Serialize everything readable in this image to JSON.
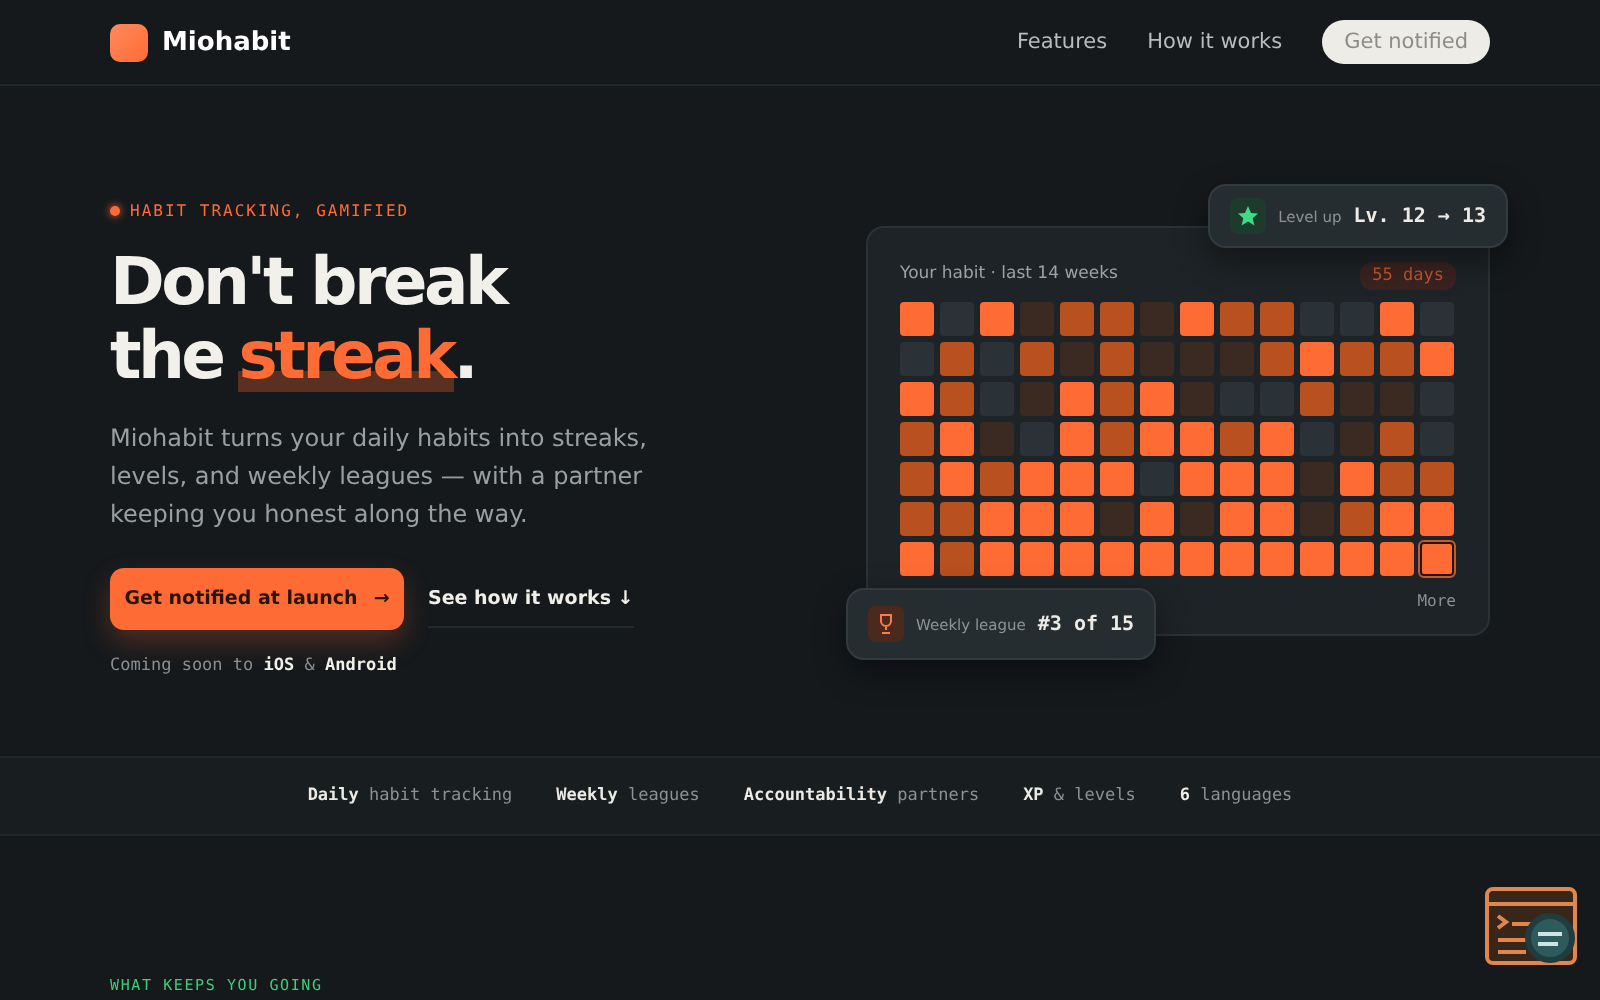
{
  "header": {
    "brand": "Miohabit",
    "nav": [
      "Features",
      "How it works"
    ],
    "cta": "Get notified"
  },
  "hero": {
    "eyebrow": "HABIT TRACKING, GAMIFIED",
    "heading_line1": "Don't break",
    "heading_line2_start": "the",
    "heading_highlight": "streak",
    "heading_line2_end": ".",
    "description": "Miohabit turns your daily habits into streaks, levels, and weekly leagues — with a partner keeping you honest along the way.",
    "primary_button": "Get notified at launch",
    "primary_arrow": "→",
    "secondary_link": "See how it works ↓",
    "availability": "Coming soon to **iOS** & **Android**"
  },
  "habit_card": {
    "title": "Your habit · last 14 weeks",
    "streak_badge": "55 days",
    "more": "More",
    "today_outlined": true,
    "rows": [
      [
        {
          "color": "#ff6b35"
        },
        {
          "color": "#2a3137"
        },
        {
          "color": "#ff6b35"
        },
        {
          "color": "#3b2a22"
        },
        {
          "color": "#b8501f"
        },
        {
          "color": "#b8501f"
        },
        {
          "color": "#3b2a22"
        },
        {
          "color": "#ff6b35"
        },
        {
          "color": "#b8501f"
        },
        {
          "color": "#b8501f"
        },
        {
          "color": "#2a3137"
        },
        {
          "color": "#2a3137"
        },
        {
          "color": "#ff6b35"
        },
        {
          "color": "#2a3137"
        }
      ],
      [
        {
          "color": "#2a3137"
        },
        {
          "color": "#b8501f"
        },
        {
          "color": "#2a3137"
        },
        {
          "color": "#b8501f"
        },
        {
          "color": "#3b2a22"
        },
        {
          "color": "#b8501f"
        },
        {
          "color": "#3b2a22"
        },
        {
          "color": "#3b2a22"
        },
        {
          "color": "#3b2a22"
        },
        {
          "color": "#b8501f"
        },
        {
          "color": "#ff6b35"
        },
        {
          "color": "#b8501f"
        },
        {
          "color": "#b8501f"
        },
        {
          "color": "#ff6b35"
        }
      ],
      [
        {
          "color": "#ff6b35"
        },
        {
          "color": "#b8501f"
        },
        {
          "color": "#2a3137"
        },
        {
          "color": "#3b2a22"
        },
        {
          "color": "#ff6b35"
        },
        {
          "color": "#b8501f"
        },
        {
          "color": "#ff6b35"
        },
        {
          "color": "#3b2a22"
        },
        {
          "color": "#2a3137"
        },
        {
          "color": "#2a3137"
        },
        {
          "color": "#b8501f"
        },
        {
          "color": "#3b2a22"
        },
        {
          "color": "#3b2a22"
        },
        {
          "color": "#2a3137"
        }
      ],
      [
        {
          "color": "#b8501f"
        },
        {
          "color": "#ff6b35"
        },
        {
          "color": "#3b2a22"
        },
        {
          "color": "#2a3137"
        },
        {
          "color": "#ff6b35"
        },
        {
          "color": "#b8501f"
        },
        {
          "color": "#ff6b35"
        },
        {
          "color": "#ff6b35"
        },
        {
          "color": "#b8501f"
        },
        {
          "color": "#ff6b35"
        },
        {
          "color": "#2a3137"
        },
        {
          "color": "#3b2a22"
        },
        {
          "color": "#b8501f"
        },
        {
          "color": "#2a3137"
        }
      ],
      [
        {
          "color": "#b8501f"
        },
        {
          "color": "#ff6b35"
        },
        {
          "color": "#b8501f"
        },
        {
          "color": "#ff6b35"
        },
        {
          "color": "#ff6b35"
        },
        {
          "color": "#ff6b35"
        },
        {
          "color": "#2a3137"
        },
        {
          "color": "#ff6b35"
        },
        {
          "color": "#ff6b35"
        },
        {
          "color": "#ff6b35"
        },
        {
          "color": "#3b2a22"
        },
        {
          "color": "#ff6b35"
        },
        {
          "color": "#b8501f"
        },
        {
          "color": "#b8501f"
        }
      ],
      [
        {
          "color": "#b8501f"
        },
        {
          "color": "#b8501f"
        },
        {
          "color": "#ff6b35"
        },
        {
          "color": "#ff6b35"
        },
        {
          "color": "#ff6b35"
        },
        {
          "color": "#3b2a22"
        },
        {
          "color": "#ff6b35"
        },
        {
          "color": "#3b2a22"
        },
        {
          "color": "#ff6b35"
        },
        {
          "color": "#ff6b35"
        },
        {
          "color": "#3b2a22"
        },
        {
          "color": "#b8501f"
        },
        {
          "color": "#ff6b35"
        },
        {
          "color": "#ff6b35"
        }
      ],
      [
        {
          "color": "#ff6b35"
        },
        {
          "color": "#b8501f"
        },
        {
          "color": "#ff6b35"
        },
        {
          "color": "#ff6b35"
        },
        {
          "color": "#ff6b35"
        },
        {
          "color": "#ff6b35"
        },
        {
          "color": "#ff6b35"
        },
        {
          "color": "#ff6b35"
        },
        {
          "color": "#ff6b35"
        },
        {
          "color": "#ff6b35"
        },
        {
          "color": "#ff6b35"
        },
        {
          "color": "#ff6b35"
        },
        {
          "color": "#ff6b35"
        },
        {
          "color": "#ff6b35"
        }
      ]
    ]
  },
  "level_up": {
    "label": "Level up",
    "value": "Lv. 12 → 13"
  },
  "league": {
    "label": "Weekly league",
    "value": "#3 of 15"
  },
  "features_strip": [
    "**Daily** habit tracking",
    "**Weekly** leagues",
    "**Accountability** partners",
    "**XP** & levels",
    "**6** languages"
  ],
  "section_eyebrow": "WHAT KEEPS YOU GOING"
}
